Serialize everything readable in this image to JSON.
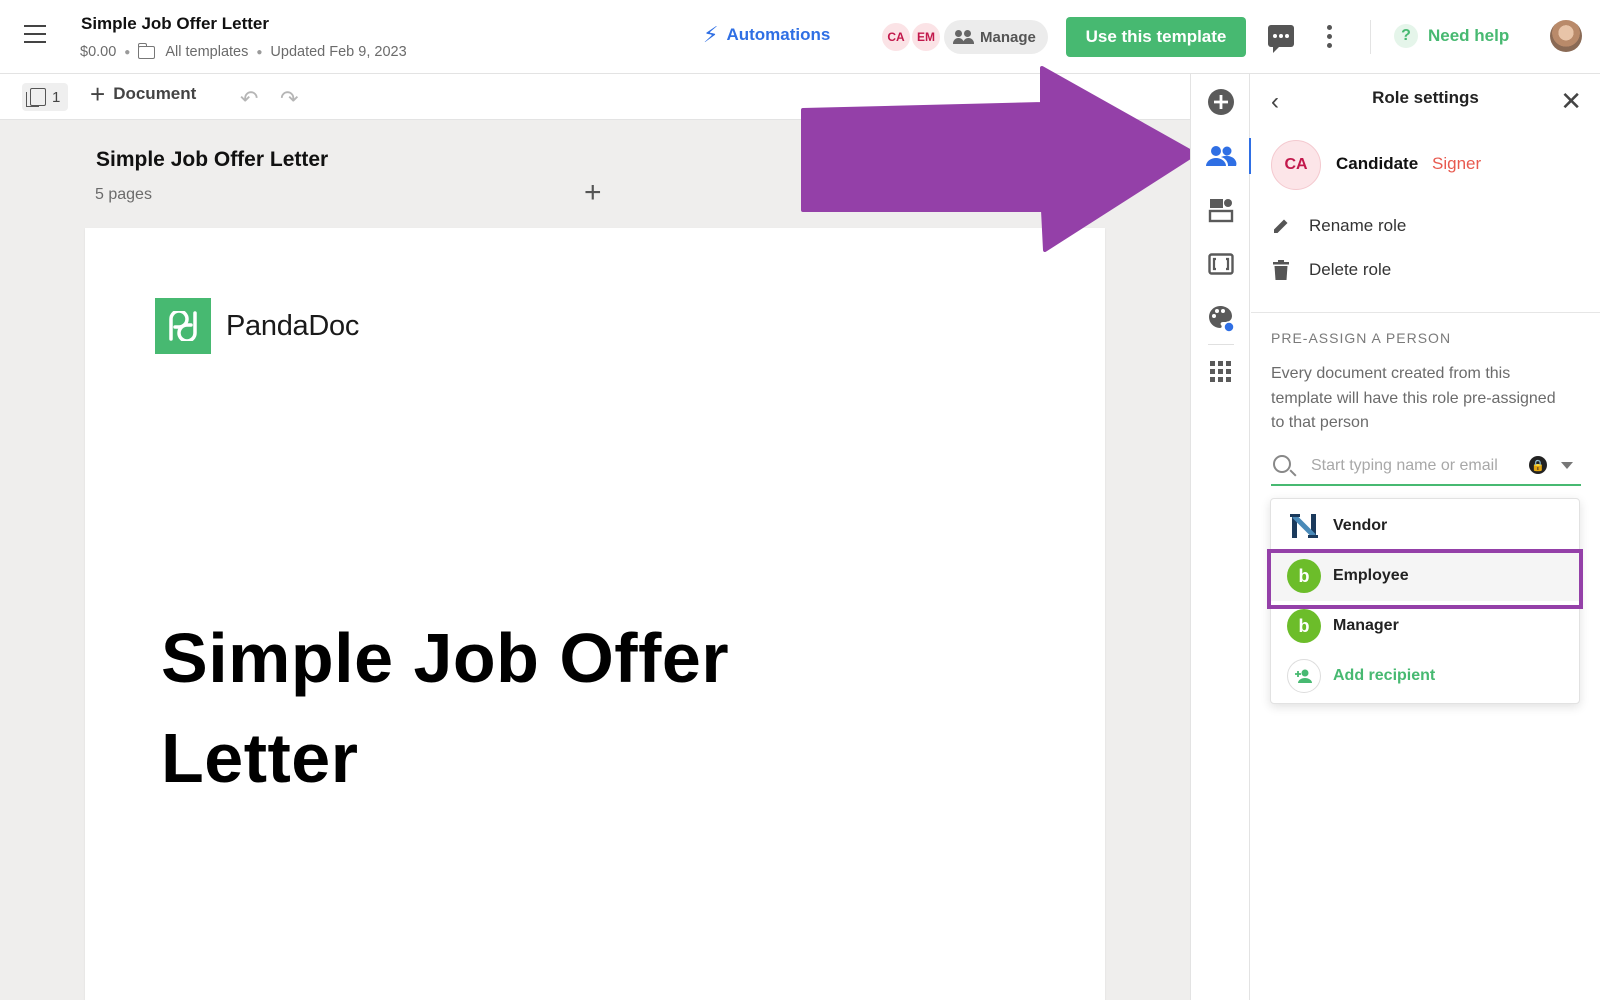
{
  "header": {
    "doc_title": "Simple Job Offer Letter",
    "price": "$0.00",
    "folder": "All templates",
    "updated": "Updated Feb 9, 2023",
    "automations_label": "Automations",
    "recipient_avatars": [
      "CA",
      "EM"
    ],
    "manage_label": "Manage",
    "use_template_label": "Use this template",
    "need_help_label": "Need help",
    "help_icon": "?"
  },
  "toolbar": {
    "page_count": "1",
    "add_document_label": "Document"
  },
  "canvas": {
    "title": "Simple Job Offer Letter",
    "pages_label": "5 pages",
    "logo_text": "PandaDoc",
    "document_heading": "Simple Job Offer Letter"
  },
  "rail": {
    "icons": [
      "add-block-icon",
      "recipients-icon",
      "content-library-icon",
      "fields-icon",
      "theme-icon",
      "apps-icon"
    ],
    "active_index": 1
  },
  "panel": {
    "title": "Role settings",
    "role_initials": "CA",
    "role_name": "Candidate",
    "role_type": "Signer",
    "rename_label": "Rename role",
    "delete_label": "Delete role",
    "section_label": "PRE-ASSIGN A PERSON",
    "section_desc": "Every document created from this template will have this role pre-assigned to that person",
    "search_placeholder": "Start typing name or email",
    "dropdown": {
      "items": [
        {
          "label": "Vendor",
          "icon": "netsuite-icon"
        },
        {
          "label": "Employee",
          "icon": "bamboo-icon"
        },
        {
          "label": "Manager",
          "icon": "bamboo-icon"
        }
      ],
      "selected_index": 1,
      "add_recipient_label": "Add recipient"
    }
  },
  "colors": {
    "brand_green": "#47b971",
    "link_blue": "#2f6fe4",
    "signer_red": "#e85a4f",
    "annotation_purple": "#9440a8"
  }
}
